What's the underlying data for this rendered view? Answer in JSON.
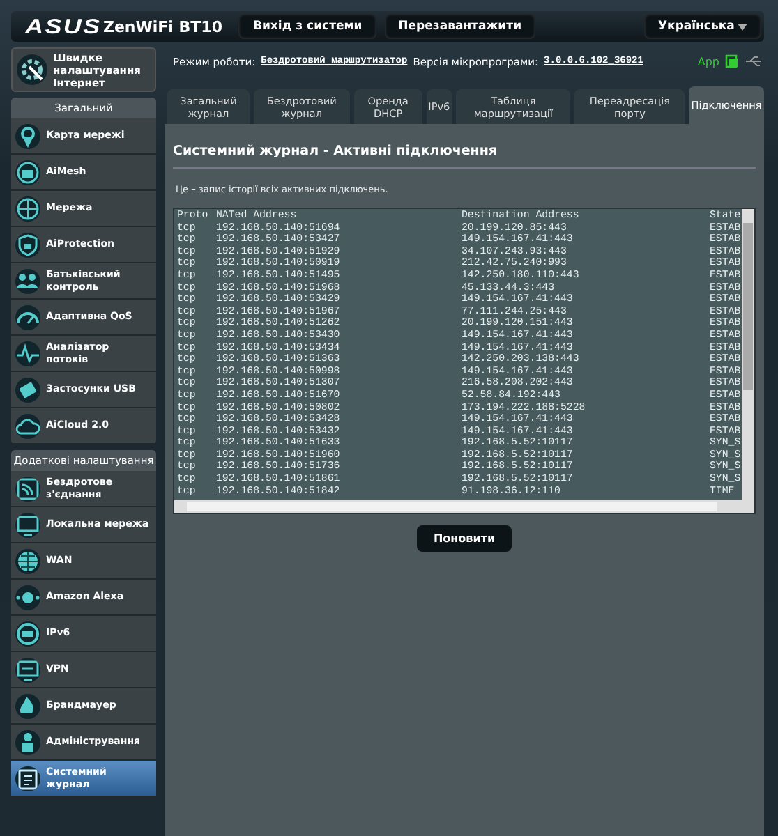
{
  "header": {
    "logo": "ASUS",
    "model": "ZenWiFi BT10",
    "buttons": [
      "Вихід з системи",
      "Перезавантажити"
    ],
    "language": "Українська"
  },
  "status": {
    "mode_label": "Режим роботи:",
    "mode": "Бездротовий маршрутизатор",
    "firmware_label": "Версія мікропрограми:",
    "firmware": "3.0.0.6.102_36921",
    "app": "App"
  },
  "sidebar": {
    "quick_setup": "Швидке налаштування Інтернет",
    "sections": [
      {
        "title": "Загальний",
        "items": [
          {
            "label": "Карта мережі",
            "selected": false
          },
          {
            "label": "AiMesh",
            "selected": false
          },
          {
            "label": "Мережа",
            "selected": false
          },
          {
            "label": "AiProtection",
            "selected": false
          },
          {
            "label": "Батьківський контроль",
            "selected": false
          },
          {
            "label": "Адаптивна QoS",
            "selected": false
          },
          {
            "label": "Аналізатор потоків",
            "selected": false
          },
          {
            "label": "Застосунки USB",
            "selected": false
          },
          {
            "label": "AiCloud 2.0",
            "selected": false
          }
        ]
      },
      {
        "title": "Додаткові налаштування",
        "items": [
          {
            "label": "Бездротове з'єднання",
            "selected": false
          },
          {
            "label": "Локальна мережа",
            "selected": false
          },
          {
            "label": "WAN",
            "selected": false
          },
          {
            "label": "Amazon Alexa",
            "selected": false
          },
          {
            "label": "IPv6",
            "selected": false
          },
          {
            "label": "VPN",
            "selected": false
          },
          {
            "label": "Брандмауер",
            "selected": false
          },
          {
            "label": "Адміністрування",
            "selected": false
          },
          {
            "label": "Системний журнал",
            "selected": true
          }
        ]
      }
    ]
  },
  "tabs": [
    {
      "label": "Загальний журнал",
      "selected": false
    },
    {
      "label": "Бездротовий журнал",
      "selected": false
    },
    {
      "label": "Оренда DHCP",
      "selected": false
    },
    {
      "label": "IPv6",
      "selected": false
    },
    {
      "label": "Таблиця маршрутизації",
      "selected": false
    },
    {
      "label": "Переадресація порту",
      "selected": false
    },
    {
      "label": "Підключення",
      "selected": true
    }
  ],
  "panel": {
    "title": "Системний журнал - Активні підключення",
    "description": "Це – запис історії всіх активних підключень.",
    "log": {
      "columns": [
        "Proto",
        "NATed Address",
        "Destination Address",
        "State"
      ],
      "rows": [
        [
          "tcp",
          "192.168.50.140:51694",
          "20.199.120.85:443",
          "ESTAB"
        ],
        [
          "tcp",
          "192.168.50.140:53427",
          "149.154.167.41:443",
          "ESTAB"
        ],
        [
          "tcp",
          "192.168.50.140:51929",
          "34.107.243.93:443",
          "ESTAB"
        ],
        [
          "tcp",
          "192.168.50.140:50919",
          "212.42.75.240:993",
          "ESTAB"
        ],
        [
          "tcp",
          "192.168.50.140:51495",
          "142.250.180.110:443",
          "ESTAB"
        ],
        [
          "tcp",
          "192.168.50.140:51968",
          "45.133.44.3:443",
          "ESTAB"
        ],
        [
          "tcp",
          "192.168.50.140:53429",
          "149.154.167.41:443",
          "ESTAB"
        ],
        [
          "tcp",
          "192.168.50.140:51967",
          "77.111.244.25:443",
          "ESTAB"
        ],
        [
          "tcp",
          "192.168.50.140:51262",
          "20.199.120.151:443",
          "ESTAB"
        ],
        [
          "tcp",
          "192.168.50.140:53430",
          "149.154.167.41:443",
          "ESTAB"
        ],
        [
          "tcp",
          "192.168.50.140:53434",
          "149.154.167.41:443",
          "ESTAB"
        ],
        [
          "tcp",
          "192.168.50.140:51363",
          "142.250.203.138:443",
          "ESTAB"
        ],
        [
          "tcp",
          "192.168.50.140:50998",
          "149.154.167.41:443",
          "ESTAB"
        ],
        [
          "tcp",
          "192.168.50.140:51307",
          "216.58.208.202:443",
          "ESTAB"
        ],
        [
          "tcp",
          "192.168.50.140:51670",
          "52.58.84.192:443",
          "ESTAB"
        ],
        [
          "tcp",
          "192.168.50.140:50802",
          "173.194.222.188:5228",
          "ESTAB"
        ],
        [
          "tcp",
          "192.168.50.140:53428",
          "149.154.167.41:443",
          "ESTAB"
        ],
        [
          "tcp",
          "192.168.50.140:53432",
          "149.154.167.41:443",
          "ESTAB"
        ],
        [
          "tcp",
          "192.168.50.140:51633",
          "192.168.5.52:10117",
          "SYN_S"
        ],
        [
          "tcp",
          "192.168.50.140:51960",
          "192.168.5.52:10117",
          "SYN_S"
        ],
        [
          "tcp",
          "192.168.50.140:51736",
          "192.168.5.52:10117",
          "SYN_S"
        ],
        [
          "tcp",
          "192.168.50.140:51861",
          "192.168.5.52:10117",
          "SYN_S"
        ],
        [
          "tcp",
          "192.168.50.140:51842",
          "91.198.36.12:110",
          "TIME"
        ]
      ]
    },
    "refresh_button": "Поновити"
  }
}
